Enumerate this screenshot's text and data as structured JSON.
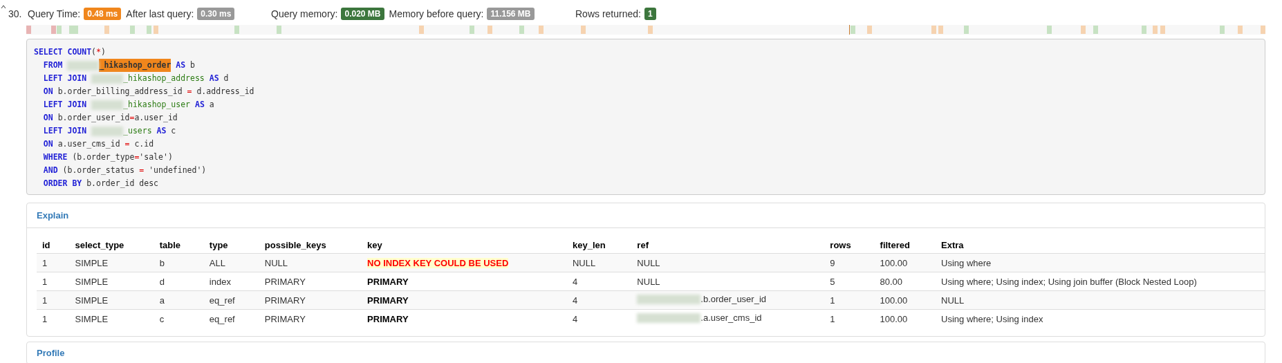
{
  "query": {
    "number": "30.",
    "metric_groups": [
      {
        "items": [
          {
            "label": "Query Time:",
            "value": "0.48 ms",
            "kind": "warning"
          },
          {
            "label": "After last query:",
            "value": "0.30 ms",
            "kind": "muted"
          }
        ]
      },
      {
        "items": [
          {
            "label": "Query memory:",
            "value": "0.020 MB",
            "kind": "success"
          },
          {
            "label": "Memory before query:",
            "value": "11.156 MB",
            "kind": "muted"
          }
        ]
      },
      {
        "items": [
          {
            "label": "Rows returned:",
            "value": "1",
            "kind": "success"
          }
        ]
      }
    ],
    "sql_lines": [
      [
        {
          "kind": "keyword",
          "text": "SELECT COUNT"
        },
        {
          "kind": "plain",
          "text": "("
        },
        {
          "kind": "op",
          "text": "*"
        },
        {
          "kind": "plain",
          "text": ")"
        }
      ],
      [
        {
          "kind": "keyword",
          "text": "  FROM "
        },
        {
          "kind": "redacted"
        },
        {
          "kind": "highlight",
          "text": "_hikashop_order"
        },
        {
          "kind": "keyword",
          "text": " AS"
        },
        {
          "kind": "plain",
          "text": " b"
        }
      ],
      [
        {
          "kind": "keyword",
          "text": "  LEFT JOIN "
        },
        {
          "kind": "redacted"
        },
        {
          "kind": "table",
          "text": "_hikashop_address"
        },
        {
          "kind": "keyword",
          "text": " AS"
        },
        {
          "kind": "plain",
          "text": " d"
        }
      ],
      [
        {
          "kind": "keyword",
          "text": "  ON"
        },
        {
          "kind": "plain",
          "text": " b.order_billing_address_id "
        },
        {
          "kind": "op",
          "text": "="
        },
        {
          "kind": "plain",
          "text": " d.address_id"
        }
      ],
      [
        {
          "kind": "keyword",
          "text": "  LEFT JOIN "
        },
        {
          "kind": "redacted"
        },
        {
          "kind": "table",
          "text": "_hikashop_user"
        },
        {
          "kind": "keyword",
          "text": " AS"
        },
        {
          "kind": "plain",
          "text": " a"
        }
      ],
      [
        {
          "kind": "keyword",
          "text": "  ON"
        },
        {
          "kind": "plain",
          "text": " b.order_user_id"
        },
        {
          "kind": "op",
          "text": "="
        },
        {
          "kind": "plain",
          "text": "a.user_id"
        }
      ],
      [
        {
          "kind": "keyword",
          "text": "  LEFT JOIN "
        },
        {
          "kind": "redacted"
        },
        {
          "kind": "table",
          "text": "_users"
        },
        {
          "kind": "keyword",
          "text": " AS"
        },
        {
          "kind": "plain",
          "text": " c"
        }
      ],
      [
        {
          "kind": "keyword",
          "text": "  ON"
        },
        {
          "kind": "plain",
          "text": " a.user_cms_id "
        },
        {
          "kind": "op",
          "text": "="
        },
        {
          "kind": "plain",
          "text": " c.id"
        }
      ],
      [
        {
          "kind": "keyword",
          "text": "  WHERE"
        },
        {
          "kind": "plain",
          "text": " (b.order_type"
        },
        {
          "kind": "op",
          "text": "="
        },
        {
          "kind": "plain",
          "text": "'sale')"
        }
      ],
      [
        {
          "kind": "keyword",
          "text": "  AND"
        },
        {
          "kind": "plain",
          "text": " (b.order_status "
        },
        {
          "kind": "op",
          "text": "="
        },
        {
          "kind": "plain",
          "text": " 'undefined')"
        }
      ],
      [
        {
          "kind": "keyword",
          "text": "  ORDER BY"
        },
        {
          "kind": "plain",
          "text": " b.order_id desc"
        }
      ]
    ],
    "explain": {
      "title": "Explain",
      "columns": [
        "id",
        "select_type",
        "table",
        "type",
        "possible_keys",
        "key",
        "key_len",
        "ref",
        "rows",
        "filtered",
        "Extra"
      ],
      "rows": [
        {
          "id": "1",
          "select_type": "SIMPLE",
          "table": "b",
          "type": "ALL",
          "possible_keys": "NULL",
          "key": {
            "text": "NO INDEX KEY COULD BE USED",
            "kind": "warning"
          },
          "key_len": "NULL",
          "ref": {
            "text": "NULL",
            "redacted": false
          },
          "rows": "9",
          "filtered": "100.00",
          "extra": "Using where"
        },
        {
          "id": "1",
          "select_type": "SIMPLE",
          "table": "d",
          "type": "index",
          "possible_keys": "PRIMARY",
          "key": {
            "text": "PRIMARY",
            "kind": "index"
          },
          "key_len": "4",
          "ref": {
            "text": "NULL",
            "redacted": false
          },
          "rows": "5",
          "filtered": "80.00",
          "extra": "Using where; Using index; Using join buffer (Block Nested Loop)"
        },
        {
          "id": "1",
          "select_type": "SIMPLE",
          "table": "a",
          "type": "eq_ref",
          "possible_keys": "PRIMARY",
          "key": {
            "text": "PRIMARY",
            "kind": "index"
          },
          "key_len": "4",
          "ref": {
            "text": ".b.order_user_id",
            "redacted": true
          },
          "rows": "1",
          "filtered": "100.00",
          "extra": "NULL"
        },
        {
          "id": "1",
          "select_type": "SIMPLE",
          "table": "c",
          "type": "eq_ref",
          "possible_keys": "PRIMARY",
          "key": {
            "text": "PRIMARY",
            "kind": "index"
          },
          "key_len": "4",
          "ref": {
            "text": ".a.user_cms_id",
            "redacted": true
          },
          "rows": "1",
          "filtered": "100.00",
          "extra": "Using where; Using index"
        }
      ]
    },
    "profile": {
      "title": "Profile"
    }
  }
}
